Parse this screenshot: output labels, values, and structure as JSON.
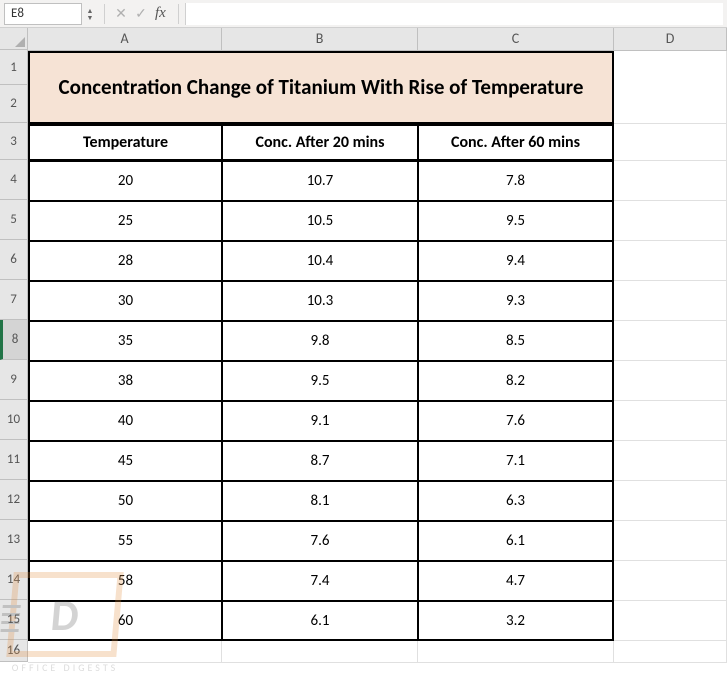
{
  "formula_bar": {
    "name_box": "E8",
    "cancel_icon": "✕",
    "confirm_icon": "✓",
    "fx_label": "fx",
    "formula_value": ""
  },
  "columns": [
    "A",
    "B",
    "C",
    "D"
  ],
  "row_numbers": [
    "1",
    "2",
    "3",
    "4",
    "5",
    "6",
    "7",
    "8",
    "9",
    "10",
    "11",
    "12",
    "13",
    "14",
    "15",
    "16"
  ],
  "selected_row_index": 7,
  "title": "Concentration Change of Titanium With Rise of Temperature",
  "headers": [
    "Temperature",
    "Conc. After 20 mins",
    "Conc. After 60 mins"
  ],
  "rows": [
    [
      "20",
      "10.7",
      "7.8"
    ],
    [
      "25",
      "10.5",
      "9.5"
    ],
    [
      "28",
      "10.4",
      "9.4"
    ],
    [
      "30",
      "10.3",
      "9.3"
    ],
    [
      "35",
      "9.8",
      "8.5"
    ],
    [
      "38",
      "9.5",
      "8.2"
    ],
    [
      "40",
      "9.1",
      "7.6"
    ],
    [
      "45",
      "8.7",
      "7.1"
    ],
    [
      "50",
      "8.1",
      "6.3"
    ],
    [
      "55",
      "7.6",
      "6.1"
    ],
    [
      "58",
      "7.4",
      "4.7"
    ],
    [
      "60",
      "6.1",
      "3.2"
    ]
  ],
  "watermark": {
    "letter": "D",
    "text": "OFFICE DIGESTS"
  },
  "row_heights": {
    "title1": 35,
    "title2": 38,
    "header": 37,
    "data": 40,
    "last": 22
  }
}
